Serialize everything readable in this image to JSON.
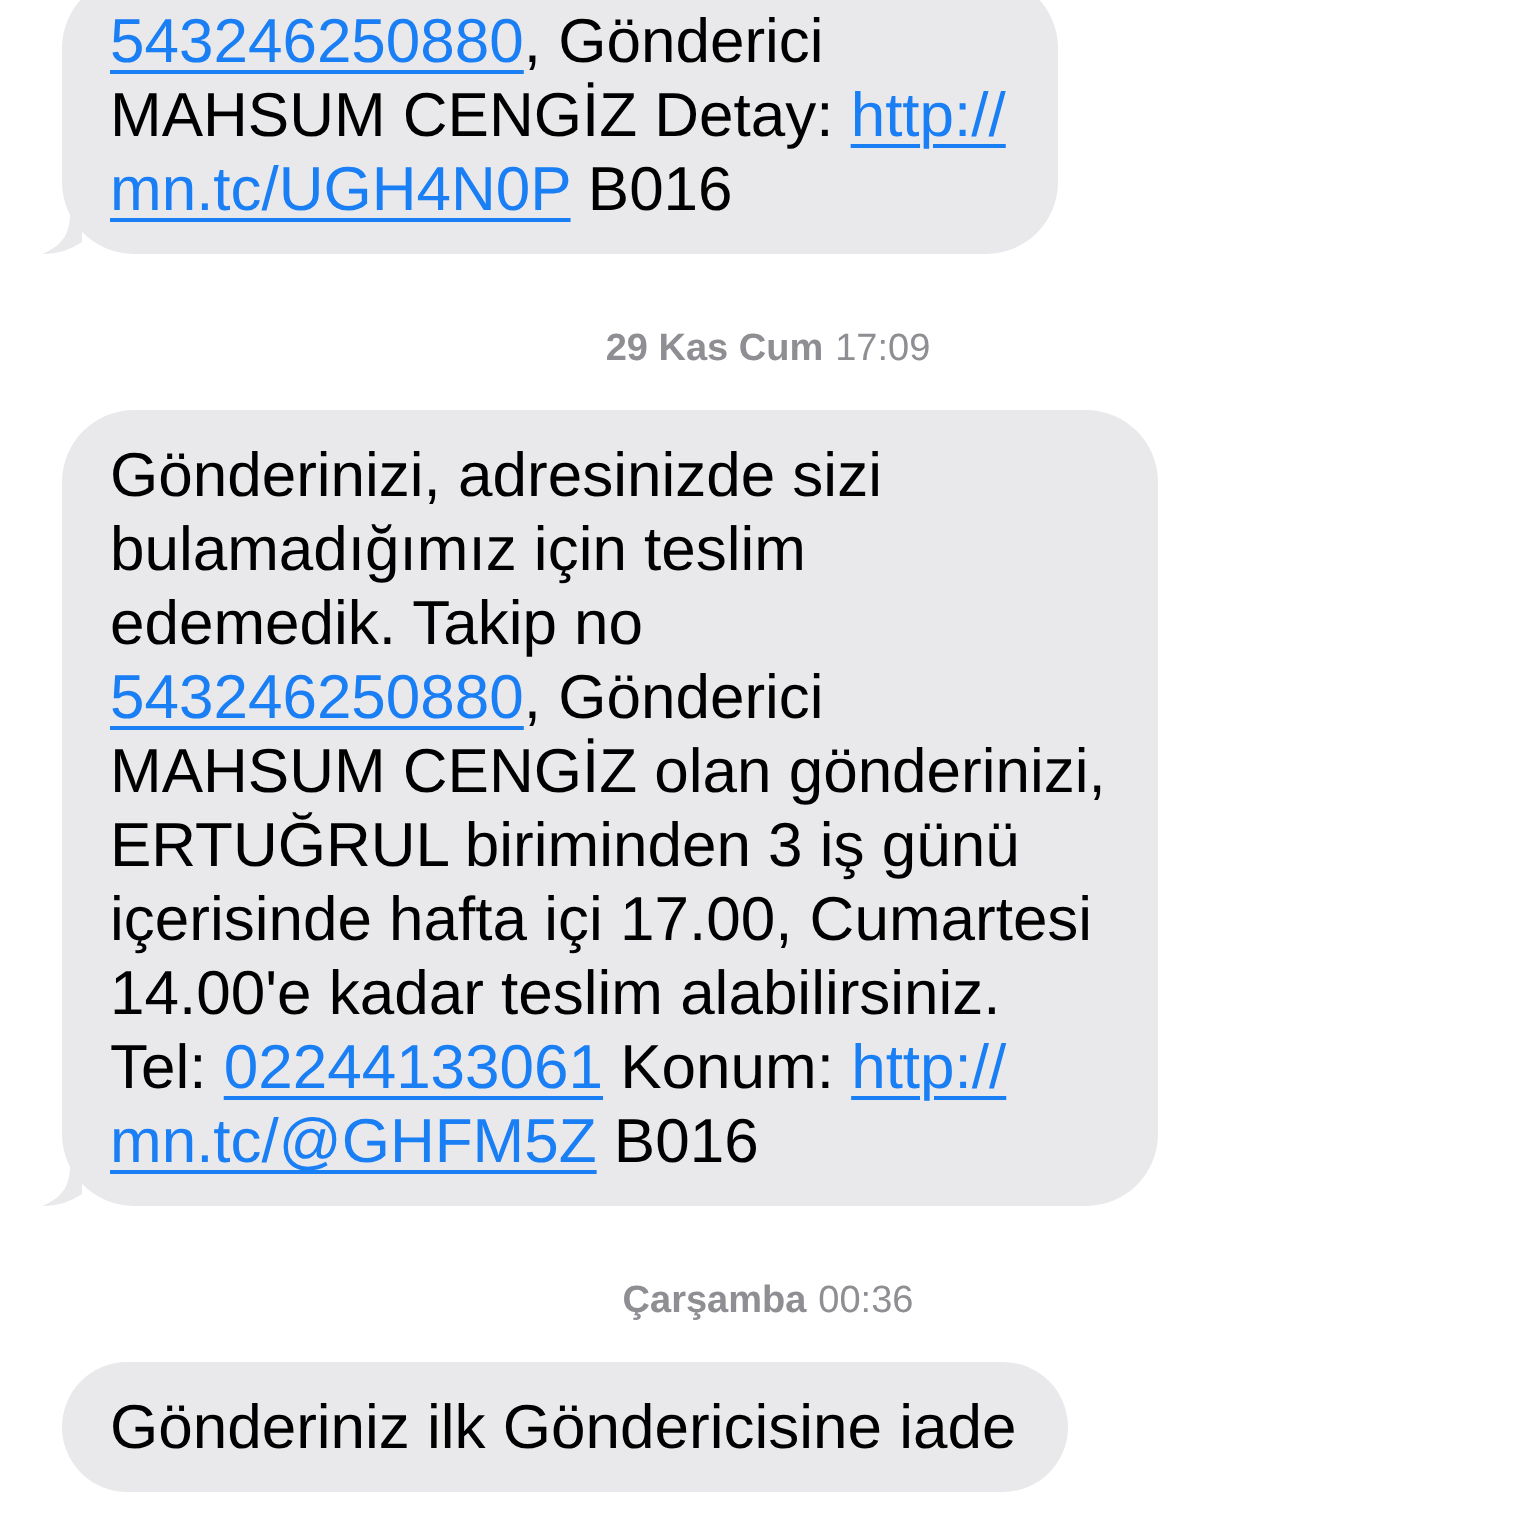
{
  "thread": [
    {
      "kind": "message",
      "tail": true,
      "lines": [
        [
          {
            "kind": "link",
            "text": "543246250880"
          },
          {
            "kind": "text",
            "text": ", Gönderici"
          }
        ],
        [
          {
            "kind": "text",
            "text": "MAHSUM CENGİZ Detay: "
          },
          {
            "kind": "link",
            "text": "http://"
          }
        ],
        [
          {
            "kind": "link",
            "text": "mn.tc/UGH4N0P"
          },
          {
            "kind": "text",
            "text": " B016"
          }
        ]
      ]
    },
    {
      "kind": "timestamp",
      "date": "29 Kas Cum",
      "time": "17:09"
    },
    {
      "kind": "message",
      "tail": true,
      "lines": [
        [
          {
            "kind": "text",
            "text": "Gönderinizi, adresinizde sizi"
          }
        ],
        [
          {
            "kind": "text",
            "text": "bulamadığımız için teslim"
          }
        ],
        [
          {
            "kind": "text",
            "text": "edemedik. Takip no"
          }
        ],
        [
          {
            "kind": "link",
            "text": "543246250880"
          },
          {
            "kind": "text",
            "text": ", Gönderici"
          }
        ],
        [
          {
            "kind": "text",
            "text": "MAHSUM CENGİZ olan gönderinizi,"
          }
        ],
        [
          {
            "kind": "text",
            "text": "ERTUĞRUL biriminden 3 iş günü"
          }
        ],
        [
          {
            "kind": "text",
            "text": "içerisinde hafta içi 17.00, Cumartesi"
          }
        ],
        [
          {
            "kind": "text",
            "text": "14.00'e kadar teslim alabilirsiniz."
          }
        ],
        [
          {
            "kind": "text",
            "text": "Tel: "
          },
          {
            "kind": "link",
            "text": "02244133061"
          },
          {
            "kind": "text",
            "text": " Konum: "
          },
          {
            "kind": "link",
            "text": "http://"
          }
        ],
        [
          {
            "kind": "link",
            "text": "mn.tc/@GHFM5Z"
          },
          {
            "kind": "text",
            "text": " B016"
          }
        ]
      ]
    },
    {
      "kind": "timestamp",
      "date": "Çarşamba",
      "time": "00:36"
    },
    {
      "kind": "message",
      "tail": false,
      "lines": [
        [
          {
            "kind": "text",
            "text": "Gönderiniz ilk Göndericisine iade"
          }
        ]
      ]
    }
  ]
}
